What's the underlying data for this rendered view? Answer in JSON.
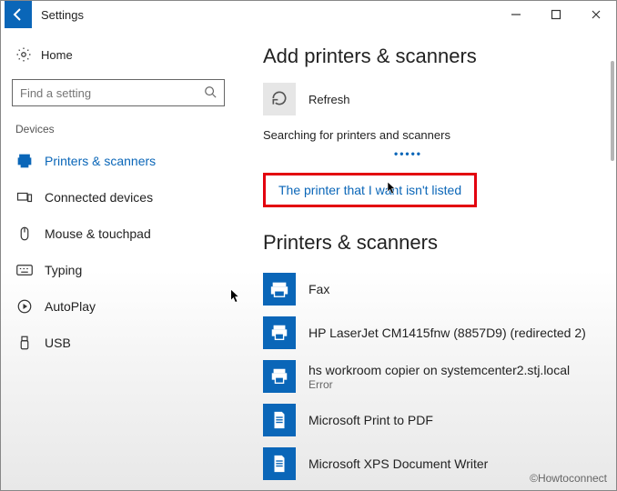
{
  "titlebar": {
    "title": "Settings"
  },
  "sidebar": {
    "home": "Home",
    "search_placeholder": "Find a setting",
    "section": "Devices",
    "items": [
      {
        "label": "Printers & scanners",
        "icon": "printer-icon",
        "active": true
      },
      {
        "label": "Connected devices",
        "icon": "devices-icon"
      },
      {
        "label": "Mouse & touchpad",
        "icon": "mouse-icon"
      },
      {
        "label": "Typing",
        "icon": "keyboard-icon"
      },
      {
        "label": "AutoPlay",
        "icon": "autoplay-icon"
      },
      {
        "label": "USB",
        "icon": "usb-icon"
      }
    ]
  },
  "content": {
    "heading_add": "Add printers & scanners",
    "refresh_label": "Refresh",
    "searching": "Searching for printers and scanners",
    "not_listed_link": "The printer that I want isn't listed",
    "heading_list": "Printers & scanners",
    "printers": [
      {
        "name": "Fax",
        "icon": "fax-icon"
      },
      {
        "name": "HP LaserJet CM1415fnw (8857D9) (redirected 2)",
        "icon": "printer-device-icon"
      },
      {
        "name": "hs workroom copier on systemcenter2.stj.local",
        "status": "Error",
        "icon": "printer-device-icon"
      },
      {
        "name": "Microsoft Print to PDF",
        "icon": "print-pdf-icon"
      },
      {
        "name": "Microsoft XPS Document Writer",
        "icon": "print-xps-icon"
      }
    ]
  },
  "watermark": "©Howtoconnect",
  "colors": {
    "accent": "#0a66b8",
    "highlight_border": "#e3000f"
  }
}
